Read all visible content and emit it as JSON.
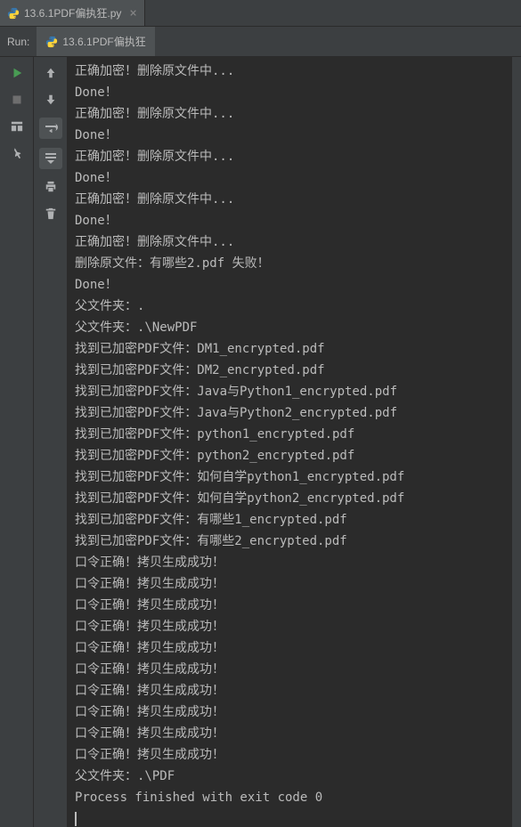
{
  "file_tabs": {
    "active_tab_label": "13.6.1PDF偏执狂.py"
  },
  "run_bar": {
    "label": "Run:",
    "tab_label": "13.6.1PDF偏执狂"
  },
  "console_lines": [
    "正确加密！删除原文件中...",
    "Done！",
    "正确加密！删除原文件中...",
    "Done！",
    "正确加密！删除原文件中...",
    "Done！",
    "正确加密！删除原文件中...",
    "Done！",
    "正确加密！删除原文件中...",
    "删除原文件：有哪些2.pdf 失败！",
    "Done！",
    "父文件夹：.",
    "父文件夹：.\\NewPDF",
    "找到已加密PDF文件：DM1_encrypted.pdf",
    "找到已加密PDF文件：DM2_encrypted.pdf",
    "找到已加密PDF文件：Java与Python1_encrypted.pdf",
    "找到已加密PDF文件：Java与Python2_encrypted.pdf",
    "找到已加密PDF文件：python1_encrypted.pdf",
    "找到已加密PDF文件：python2_encrypted.pdf",
    "找到已加密PDF文件：如何自学python1_encrypted.pdf",
    "找到已加密PDF文件：如何自学python2_encrypted.pdf",
    "找到已加密PDF文件：有哪些1_encrypted.pdf",
    "找到已加密PDF文件：有哪些2_encrypted.pdf",
    "口令正确！拷贝生成成功！",
    "口令正确！拷贝生成成功！",
    "口令正确！拷贝生成成功！",
    "口令正确！拷贝生成成功！",
    "口令正确！拷贝生成成功！",
    "口令正确！拷贝生成成功！",
    "口令正确！拷贝生成成功！",
    "口令正确！拷贝生成成功！",
    "口令正确！拷贝生成成功！",
    "口令正确！拷贝生成成功！",
    "父文件夹：.\\PDF",
    "",
    "Process finished with exit code 0"
  ]
}
